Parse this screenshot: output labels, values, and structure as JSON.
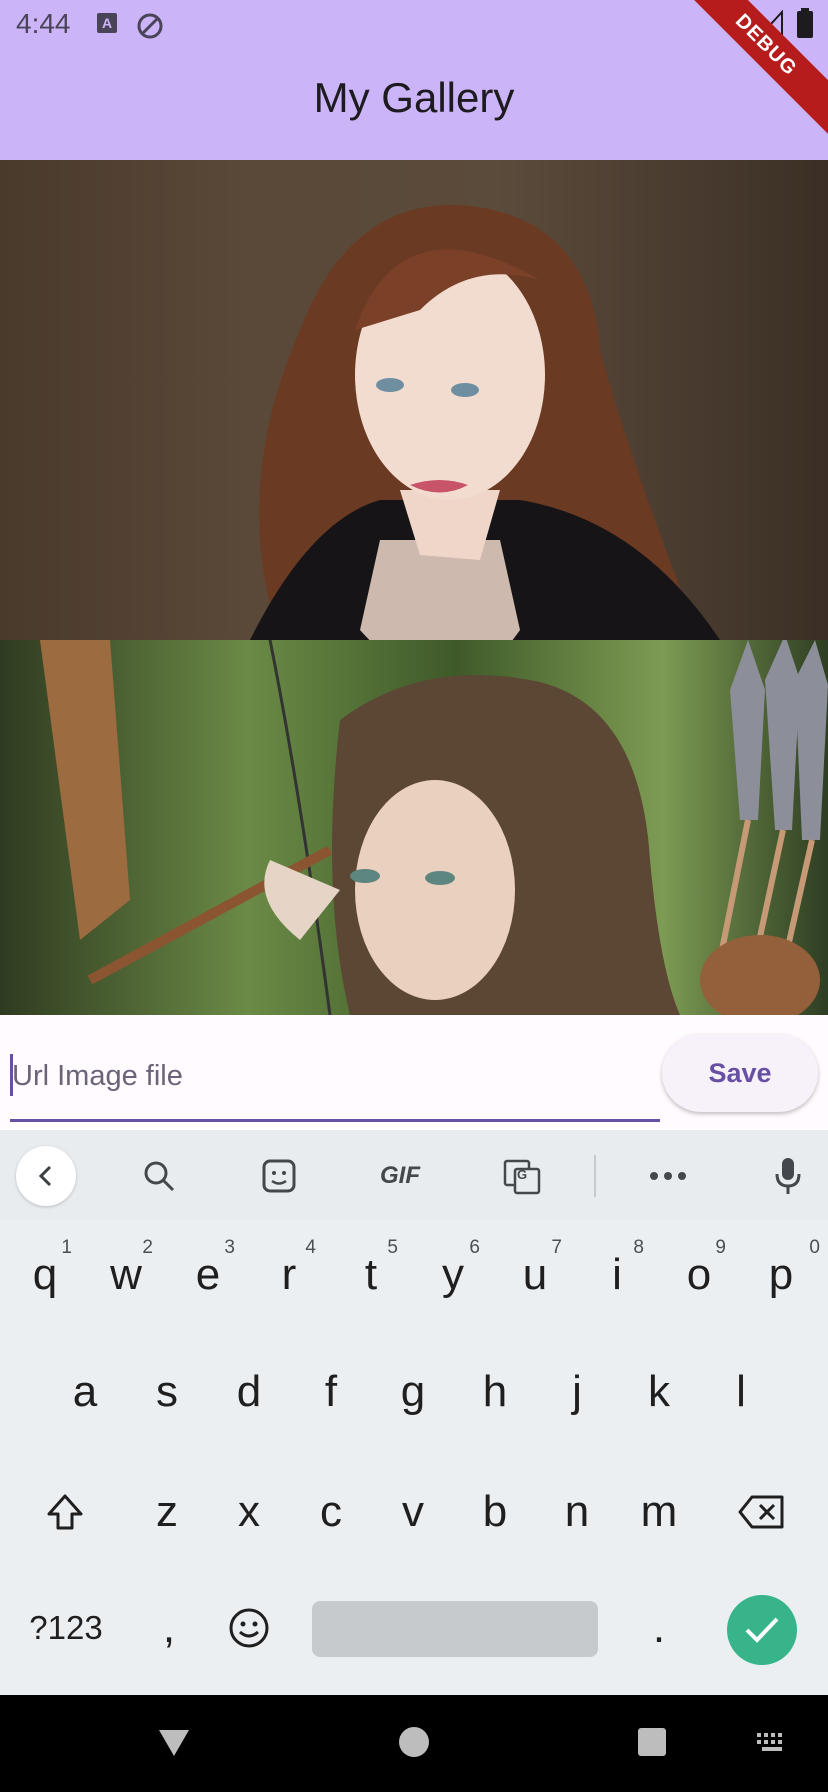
{
  "status_bar": {
    "time": "4:44"
  },
  "app": {
    "title": "My Gallery",
    "debug_badge": "DEBUG"
  },
  "input": {
    "placeholder": "Url Image file",
    "value": ""
  },
  "save_button": {
    "label": "Save"
  },
  "keyboard": {
    "toolbar": [
      "back-chevron",
      "search",
      "sticker",
      "GIF",
      "translate",
      "more",
      "mic"
    ],
    "gif_label": "GIF",
    "row1": [
      {
        "k": "q",
        "n": "1"
      },
      {
        "k": "w",
        "n": "2"
      },
      {
        "k": "e",
        "n": "3"
      },
      {
        "k": "r",
        "n": "4"
      },
      {
        "k": "t",
        "n": "5"
      },
      {
        "k": "y",
        "n": "6"
      },
      {
        "k": "u",
        "n": "7"
      },
      {
        "k": "i",
        "n": "8"
      },
      {
        "k": "o",
        "n": "9"
      },
      {
        "k": "p",
        "n": "0"
      }
    ],
    "row2": [
      "a",
      "s",
      "d",
      "f",
      "g",
      "h",
      "j",
      "k",
      "l"
    ],
    "row3": [
      "z",
      "x",
      "c",
      "v",
      "b",
      "n",
      "m"
    ],
    "symbols_label": "?123",
    "comma": ",",
    "period": "."
  },
  "colors": {
    "accent": "#6750a4",
    "appbar": "#cbb4f7",
    "enter": "#38b48b"
  }
}
